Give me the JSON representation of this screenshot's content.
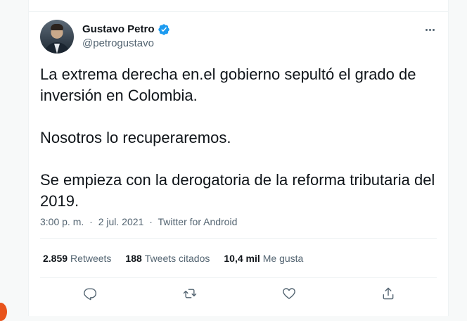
{
  "author": {
    "name": "Gustavo Petro",
    "handle": "@petrogustavo",
    "verified": true
  },
  "tweet": {
    "text": "La extrema derecha en.el gobierno sepultó el grado de inversión en Colombia.\n\nNosotros lo recuperaremos.\n\nSe empieza con la derogatoria de la reforma tributaria del 2019."
  },
  "meta": {
    "time": "3:00 p. m.",
    "separator": "·",
    "date": "2 jul. 2021",
    "source": "Twitter for Android"
  },
  "stats": {
    "retweets_count": "2.859",
    "retweets_label": "Retweets",
    "quotes_count": "188",
    "quotes_label": "Tweets citados",
    "likes_count": "10,4 mil",
    "likes_label": "Me gusta"
  },
  "colors": {
    "accent": "#1d9bf0",
    "text": "#0f1419",
    "secondary": "#536471",
    "border": "#eff3f4"
  },
  "icons": {
    "verified": "verified-badge-icon",
    "more": "more-dots-icon",
    "reply": "reply-icon",
    "retweet": "retweet-icon",
    "like": "heart-icon",
    "share": "share-icon"
  }
}
